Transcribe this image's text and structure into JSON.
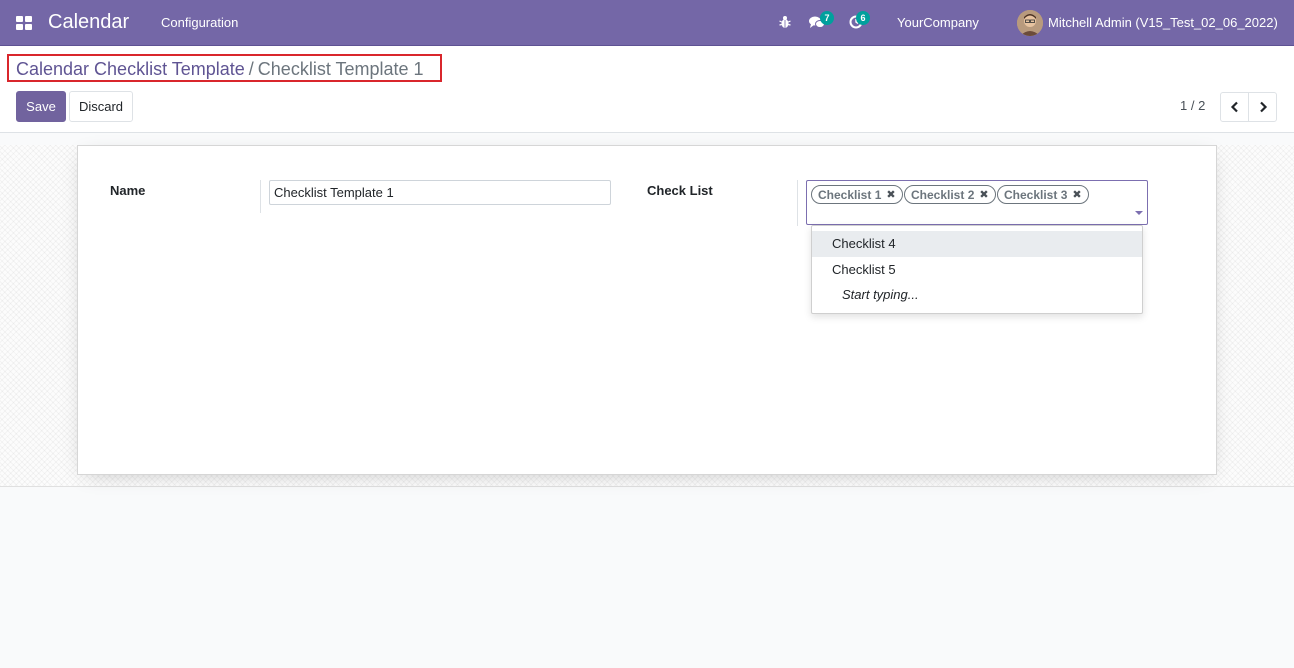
{
  "navbar": {
    "app_name": "Calendar",
    "menu": [
      "Configuration"
    ],
    "chat_count": "7",
    "activity_count": "6",
    "company": "YourCompany",
    "user": "Mitchell Admin (V15_Test_02_06_2022)",
    "color": "#7467a7"
  },
  "breadcrumb": {
    "parent": "Calendar Checklist Template",
    "separator": "/",
    "current": "Checklist Template 1"
  },
  "buttons": {
    "save": "Save",
    "discard": "Discard"
  },
  "pager": {
    "value": "1 / 2"
  },
  "form": {
    "name_label": "Name",
    "name_value": "Checklist Template 1",
    "checklist_label": "Check List",
    "tags": [
      "Checklist 1",
      "Checklist 2",
      "Checklist 3"
    ],
    "dropdown": [
      "Checklist 4",
      "Checklist 5",
      "Start typing..."
    ]
  },
  "icons": {
    "apps": "apps-grid-icon",
    "bug": "bug-icon",
    "chat": "chat-icon",
    "activity": "clock-icon",
    "prev": "chevron-left-icon",
    "next": "chevron-right-icon",
    "remove": "times-icon",
    "dropdown": "caret-down-icon"
  }
}
